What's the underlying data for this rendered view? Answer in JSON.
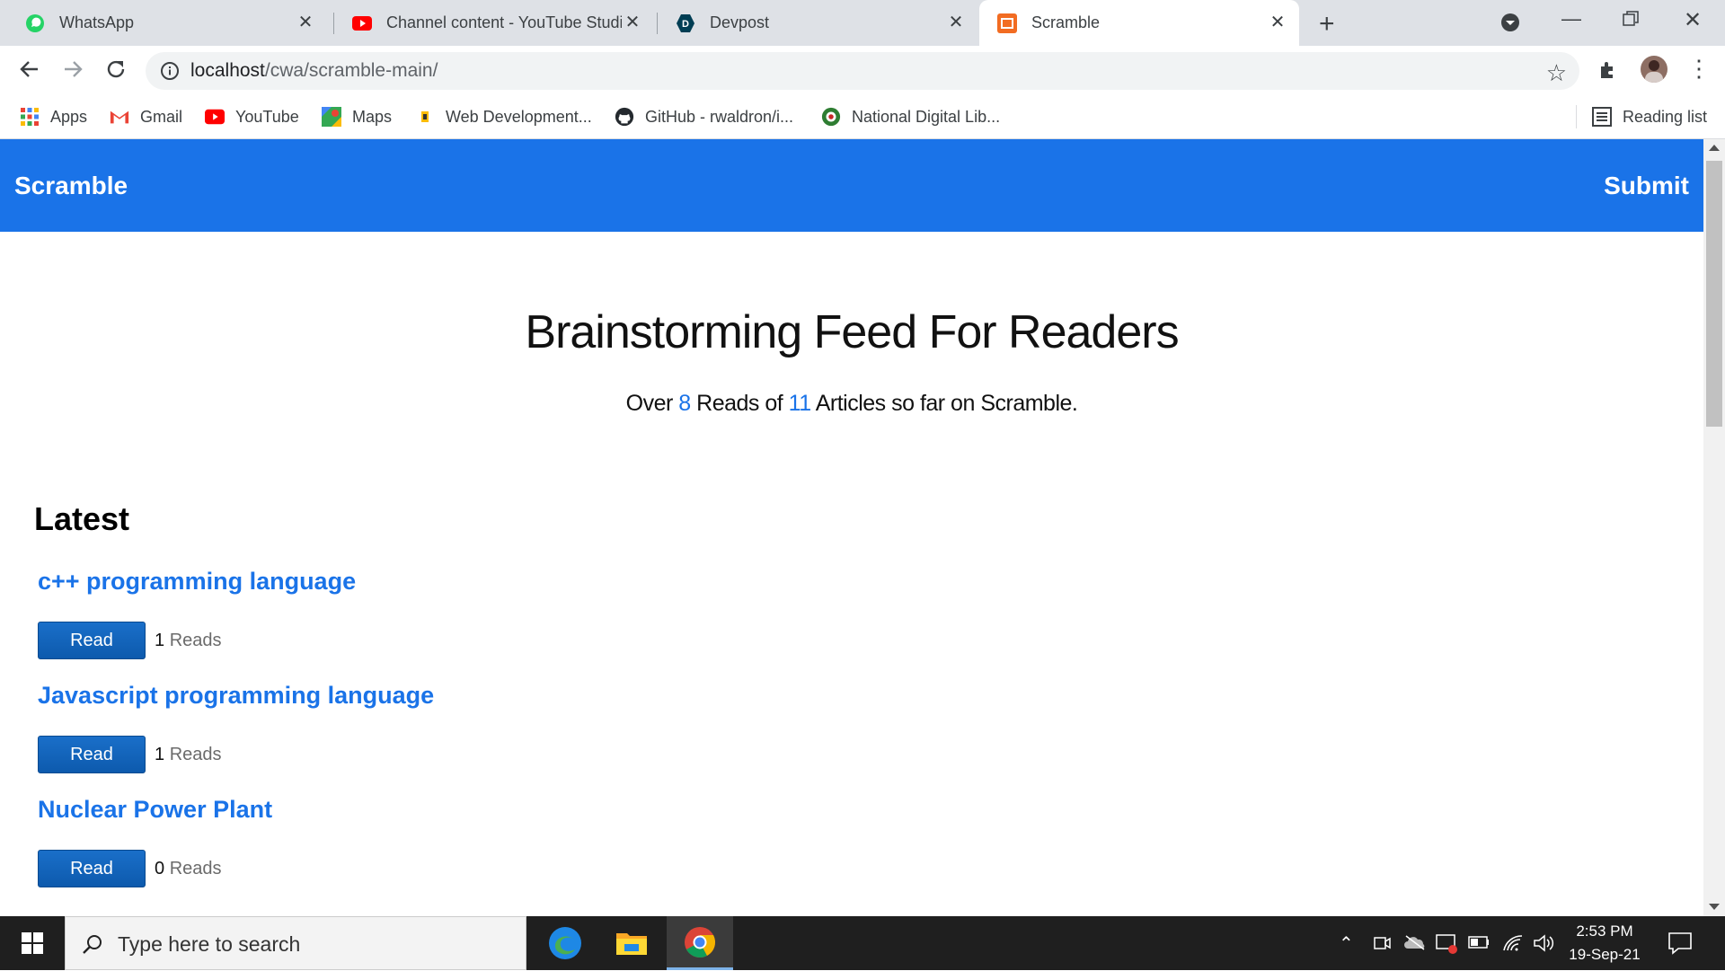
{
  "browser": {
    "tabs": [
      {
        "title": "WhatsApp",
        "icon": "whatsapp-icon"
      },
      {
        "title": "Channel content - YouTube Studio",
        "icon": "youtube-icon"
      },
      {
        "title": "Devpost",
        "icon": "devpost-icon"
      },
      {
        "title": "Scramble",
        "icon": "scramble-icon",
        "active": true
      }
    ],
    "url_host": "localhost",
    "url_path": "/cwa/scramble-main/",
    "bookmarks": [
      {
        "label": "Apps",
        "icon": "apps-grid-icon"
      },
      {
        "label": "Gmail",
        "icon": "gmail-icon"
      },
      {
        "label": "YouTube",
        "icon": "youtube-icon"
      },
      {
        "label": "Maps",
        "icon": "maps-icon"
      },
      {
        "label": "Web Development...",
        "icon": "bookmark-icon"
      },
      {
        "label": "GitHub - rwaldron/i...",
        "icon": "github-icon"
      },
      {
        "label": "National Digital Lib...",
        "icon": "ndl-icon"
      }
    ],
    "reading_list": "Reading list"
  },
  "site": {
    "brand": "Scramble",
    "submit": "Submit",
    "headline": "Brainstorming Feed For Readers",
    "sub_prefix": "Over",
    "sub_reads_count": "8",
    "sub_middle": "Reads of",
    "sub_articles_count": "11",
    "sub_suffix": "Articles so far on Scramble.",
    "latest_heading": "Latest",
    "read_label": "Read",
    "reads_suffix": "Reads",
    "articles": [
      {
        "title": "c++ programming language",
        "reads": "1"
      },
      {
        "title": "Javascript programming language",
        "reads": "1"
      },
      {
        "title": "Nuclear Power Plant",
        "reads": "0"
      }
    ]
  },
  "taskbar": {
    "search_placeholder": "Type here to search",
    "time": "2:53 PM",
    "date": "19-Sep-21"
  },
  "colors": {
    "brand_blue": "#1a73e8",
    "read_button": "#0d5aad",
    "taskbar": "#1f1f1f"
  }
}
